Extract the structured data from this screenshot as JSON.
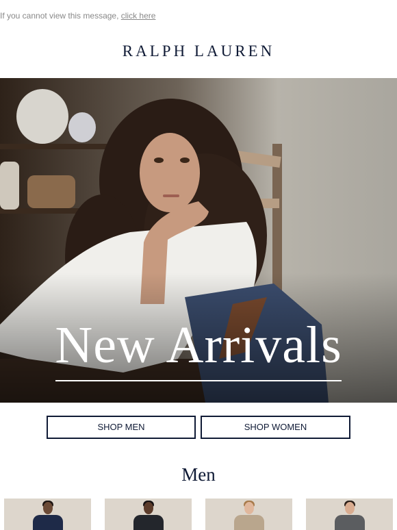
{
  "preheader": {
    "text": "If you cannot view this message, ",
    "link": "click here"
  },
  "brand": {
    "logo_text": "RALPH LAUREN"
  },
  "hero": {
    "title": "New Arrivals",
    "image": "woman-in-denim-overalls-photo"
  },
  "buttons": {
    "shop_men": "SHOP MEN",
    "shop_women": "SHOP WOMEN"
  },
  "men_section": {
    "title": "Men",
    "products": [
      {
        "image": "man-in-navy-blazer-photo"
      },
      {
        "image": "man-in-dark-jacket-photo"
      },
      {
        "image": "man-in-tan-sweater-photo"
      },
      {
        "image": "man-in-grey-coat-photo"
      }
    ]
  },
  "colors": {
    "navy": "#0f1a35",
    "preheader_gray": "#888888",
    "product_bg": "#ddd6cc"
  }
}
